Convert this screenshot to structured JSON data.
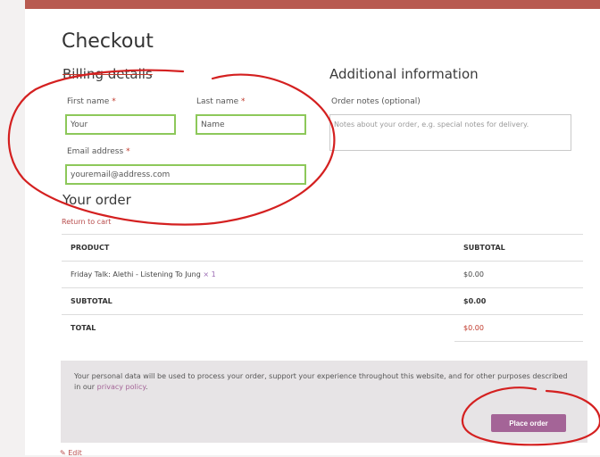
{
  "header": {
    "title": "Checkout"
  },
  "billing": {
    "heading": "Billing details",
    "first_name": {
      "label": "First name",
      "required": "*",
      "value": "Your"
    },
    "last_name": {
      "label": "Last name",
      "required": "*",
      "value": "Name"
    },
    "email": {
      "label": "Email address",
      "required": "*",
      "value": "youremail@address.com"
    }
  },
  "additional": {
    "heading": "Additional information",
    "order_notes_label": "Order notes (optional)",
    "order_notes_placeholder": "Notes about your order, e.g. special notes for delivery."
  },
  "order": {
    "heading": "Your order",
    "return_link": "Return to cart",
    "columns": [
      "PRODUCT",
      "SUBTOTAL"
    ],
    "product_name": "Friday Talk: Alethi - Listening To Jung",
    "product_qty": "× 1",
    "product_subtotal": "$0.00",
    "subtotal_label": "SUBTOTAL",
    "subtotal_value": "$0.00",
    "total_label": "TOTAL",
    "total_value": "$0.00"
  },
  "payment": {
    "privacy_text_before": "Your personal data will be used to process your order, support your experience throughout this website, and for other purposes described in our ",
    "privacy_link": "privacy policy",
    "privacy_text_after": ".",
    "place_order_label": "Place order"
  },
  "footer": {
    "edit_label": "Edit"
  },
  "colors": {
    "accent": "#a46497",
    "annotation": "#d42020",
    "field_border": "#8dc85a"
  }
}
